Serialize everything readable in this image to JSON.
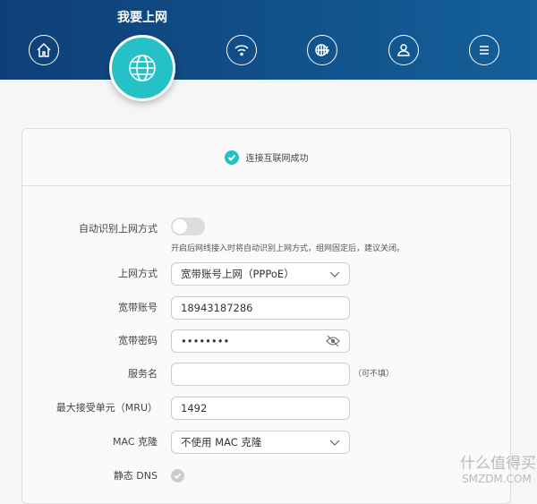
{
  "header": {
    "title": "我要上网",
    "nav": [
      "home-icon",
      "globe-icon",
      "wifi-icon",
      "network-settings-icon",
      "user-icon",
      "menu-icon"
    ]
  },
  "status": {
    "text": "连接互联网成功"
  },
  "form": {
    "auto_detect": {
      "label": "自动识别上网方式",
      "on": false,
      "help": "开启后网线接入时将自动识别上网方式，组网固定后，建议关闭。"
    },
    "mode": {
      "label": "上网方式",
      "value": "宽带账号上网（PPPoE）"
    },
    "account": {
      "label": "宽带账号",
      "value": "18943187286"
    },
    "password": {
      "label": "宽带密码",
      "value": "••••••••"
    },
    "service": {
      "label": "服务名",
      "value": "",
      "note": "（可不填）"
    },
    "mru": {
      "label": "最大接受单元（MRU）",
      "value": "1492"
    },
    "mac": {
      "label": "MAC 克隆",
      "value": "不使用 MAC 克隆"
    },
    "dns": {
      "label": "静态 DNS"
    }
  },
  "watermark": {
    "line1": "什么值得买",
    "line2": "SMZDM.COM"
  }
}
